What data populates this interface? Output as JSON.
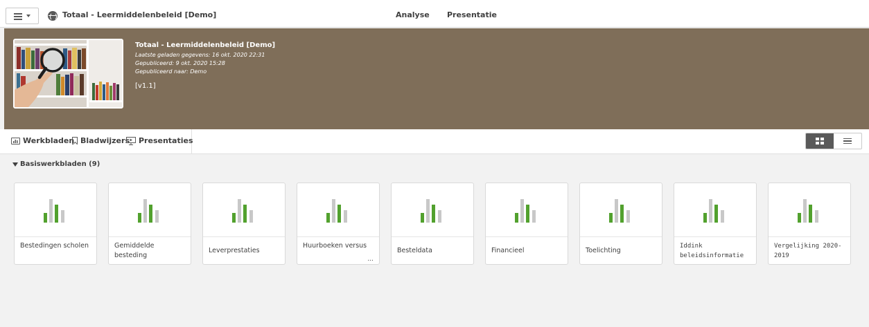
{
  "topbar": {
    "app_title": "Totaal - Leermiddelenbeleid [Demo]",
    "nav": [
      "Analyse",
      "Presentatie"
    ]
  },
  "hero": {
    "title": "Totaal - Leermiddelenbeleid [Demo]",
    "last_loaded": "Laatste geladen gegevens: 16 okt. 2020 22:31",
    "published": "Gepubliceerd: 9 okt. 2020 15:28",
    "published_to": "Gepubliceerd naar: Demo",
    "version": "[v1.1]"
  },
  "tabs": {
    "sheets": "Werkbladen",
    "bookmarks": "Bladwijzers",
    "presentations": "Presentaties"
  },
  "section": {
    "title": "Basiswerkbladen (9)"
  },
  "colors": {
    "hero_bg": "#7f6e59",
    "bar_green": "#52a12e",
    "bar_grey": "#c8c8c8"
  },
  "cards": [
    {
      "label": "Bestedingen scholen"
    },
    {
      "label": "Gemiddelde besteding"
    },
    {
      "label": "Leverprestaties"
    },
    {
      "label": "Huurboeken versus",
      "ellipsis": "..."
    },
    {
      "label": "Besteldata"
    },
    {
      "label": "Financieel"
    },
    {
      "label": "Toelichting"
    },
    {
      "label": "Iddink beleidsinformatie"
    },
    {
      "label": "Vergelijking 2020-2019"
    }
  ]
}
